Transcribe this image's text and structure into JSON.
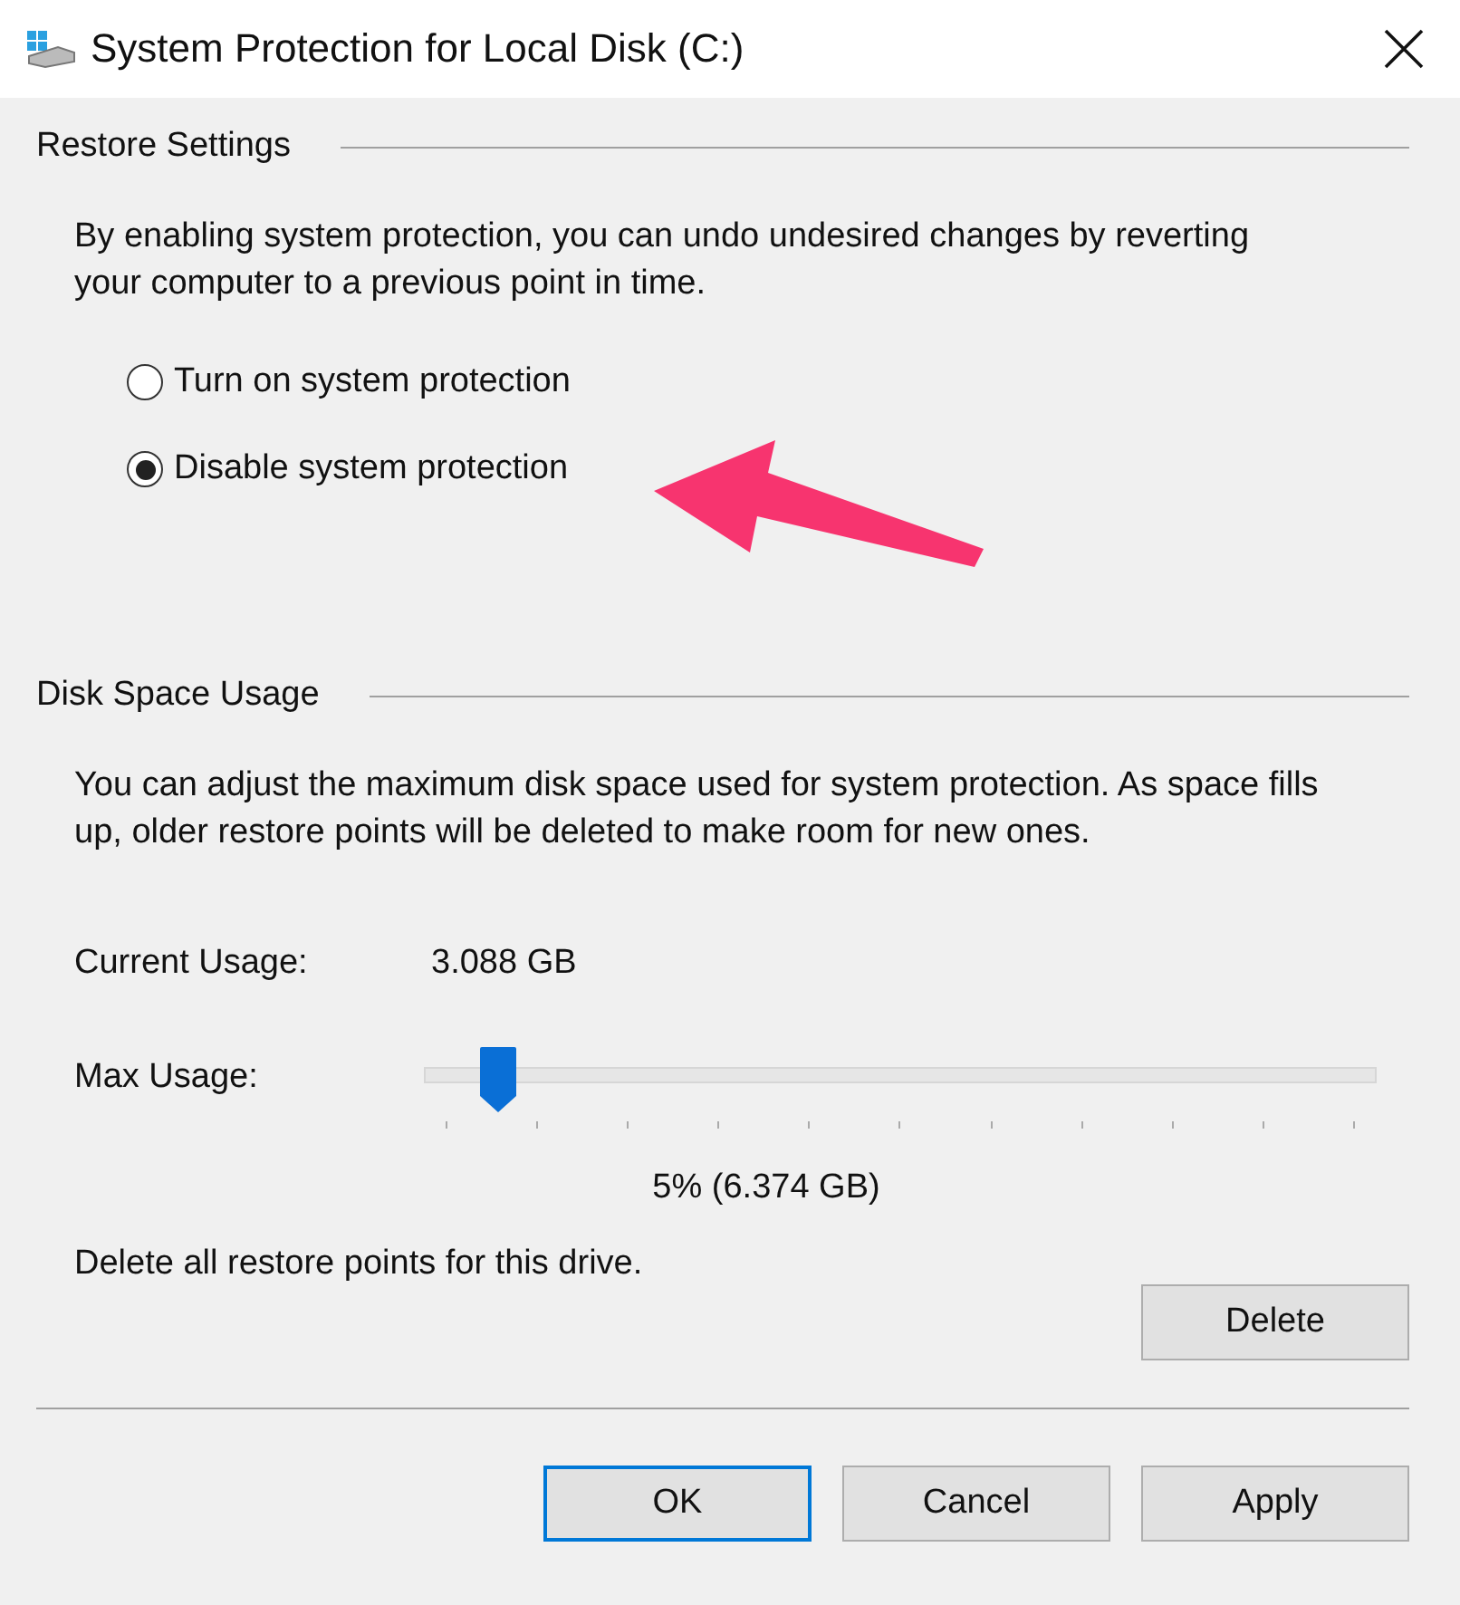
{
  "window": {
    "title": "System Protection for Local Disk (C:)"
  },
  "restore_settings": {
    "heading": "Restore Settings",
    "description": "By enabling system protection, you can undo undesired changes by reverting your computer to a previous point in time.",
    "options": [
      {
        "label": "Turn on system protection",
        "selected": false
      },
      {
        "label": "Disable system protection",
        "selected": true
      }
    ]
  },
  "disk_space_usage": {
    "heading": "Disk Space Usage",
    "description": "You can adjust the maximum disk space used for system protection. As space fills up, older restore points will be deleted to make room for new ones.",
    "current_usage_label": "Current Usage:",
    "current_usage_value": "3.088 GB",
    "max_usage_label": "Max Usage:",
    "max_usage": {
      "level": 0.04,
      "reading": "5% (6.374 GB)"
    },
    "delete_text": "Delete all restore points for this drive.",
    "delete_button": "Delete"
  },
  "buttons": [
    {
      "label": "OK",
      "selected": true
    },
    {
      "label": "Cancel",
      "selected": false
    },
    {
      "label": "Apply",
      "selected": false
    }
  ]
}
